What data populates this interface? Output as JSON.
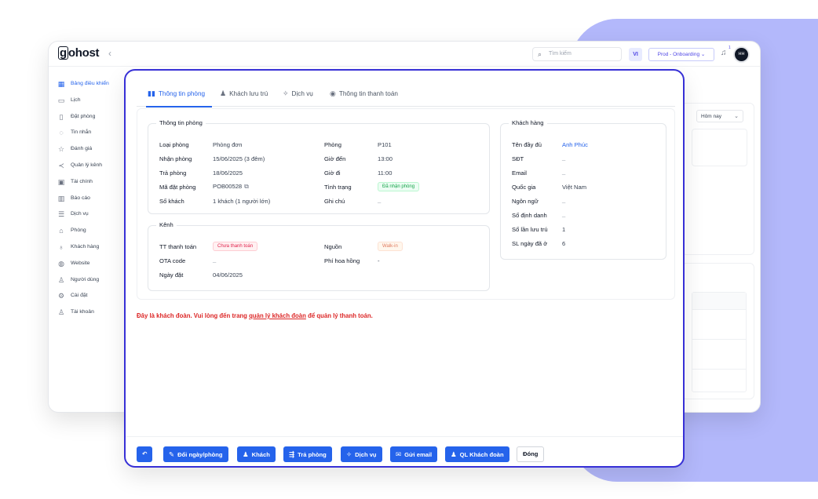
{
  "app": {
    "logo": "gohost",
    "collapse_icon": "chevron-left-icon",
    "search_placeholder": "Tìm kiếm",
    "lang": "VI",
    "env": "Prod - Onboarding",
    "notification_count": "1",
    "avatar_initials": "HH"
  },
  "sidebar": {
    "items": [
      {
        "label": "Bảng điều khiển",
        "icon": "dashboard-icon",
        "glyph": "▦"
      },
      {
        "label": "Lịch",
        "icon": "calendar-icon",
        "glyph": "▭"
      },
      {
        "label": "Đặt phòng",
        "icon": "book-icon",
        "glyph": "▯"
      },
      {
        "label": "Tin nhắn",
        "icon": "message-icon",
        "glyph": "◌"
      },
      {
        "label": "Đánh giá",
        "icon": "star-icon",
        "glyph": "☆"
      },
      {
        "label": "Quản lý kênh",
        "icon": "share-icon",
        "glyph": "≺"
      },
      {
        "label": "Tài chính",
        "icon": "wallet-icon",
        "glyph": "▣"
      },
      {
        "label": "Báo cáo",
        "icon": "chart-icon",
        "glyph": "▥"
      },
      {
        "label": "Dịch vụ",
        "icon": "list-icon",
        "glyph": "☰"
      },
      {
        "label": "Phòng",
        "icon": "building-icon",
        "glyph": "⌂"
      },
      {
        "label": "Khách hàng",
        "icon": "customers-icon",
        "glyph": "♁"
      },
      {
        "label": "Website",
        "icon": "globe-icon",
        "glyph": "◍"
      },
      {
        "label": "Người dùng",
        "icon": "users-icon",
        "glyph": "♙"
      },
      {
        "label": "Cài đặt",
        "icon": "settings-icon",
        "glyph": "⚙"
      },
      {
        "label": "Tài khoản",
        "icon": "account-icon",
        "glyph": "♙"
      }
    ]
  },
  "right_panel": {
    "filter": "Hôm nay"
  },
  "modal": {
    "tabs": [
      {
        "label": "Thông tin phòng",
        "icon": "room-info-icon",
        "glyph": "▮▮"
      },
      {
        "label": "Khách lưu trú",
        "icon": "guests-icon",
        "glyph": "♟"
      },
      {
        "label": "Dịch vụ",
        "icon": "sparkle-icon",
        "glyph": "✧"
      },
      {
        "label": "Thông tin thanh toán",
        "icon": "payment-icon",
        "glyph": "◉"
      }
    ],
    "room_info": {
      "legend": "Thông tin phòng",
      "room_type_label": "Loại phòng",
      "room_type": "Phòng đơn",
      "checkin_label": "Nhận phòng",
      "checkin": "15/06/2025 (3 đêm)",
      "checkout_label": "Trả phòng",
      "checkout": "18/06/2025",
      "booking_code_label": "Mã đặt phòng",
      "booking_code": "POB00528",
      "guests_label": "Số khách",
      "guests": "1 khách (1 người lớn)",
      "room_label": "Phòng",
      "room": "P101",
      "arrive_time_label": "Giờ đến",
      "arrive_time": "13:00",
      "leave_time_label": "Giờ đi",
      "leave_time": "11:00",
      "status_label": "Tình trạng",
      "status": "Đã nhận phòng",
      "note_label": "Ghi chú",
      "note": "_"
    },
    "channel": {
      "legend": "Kênh",
      "payment_status_label": "TT thanh toán",
      "payment_status": "Chưa thanh toán",
      "ota_code_label": "OTA code",
      "ota_code": "_",
      "booking_date_label": "Ngày đặt",
      "booking_date": "04/06/2025",
      "source_label": "Nguồn",
      "source": "Walk-in",
      "commission_label": "Phí hoa hồng",
      "commission": "-"
    },
    "customer": {
      "legend": "Khách hàng",
      "rows": [
        {
          "label": "Tên đầy đủ",
          "value": "Anh Phúc"
        },
        {
          "label": "SĐT",
          "value": "_"
        },
        {
          "label": "Email",
          "value": "_"
        },
        {
          "label": "Quốc gia",
          "value": "Việt Nam"
        },
        {
          "label": "Ngôn ngữ",
          "value": "_"
        },
        {
          "label": "Số định danh",
          "value": "_"
        },
        {
          "label": "Số lần lưu trú",
          "value": "1"
        },
        {
          "label": "SL ngày đã ở",
          "value": "6"
        }
      ]
    },
    "warning": {
      "before": "Đây là khách đoàn. Vui lòng đến trang ",
      "link": "quản lý khách đoàn",
      "after": " để quản lý thanh toán."
    },
    "footer": {
      "back_icon": "undo-icon",
      "change_label": "Đổi ngày/phòng",
      "guest_label": "Khách",
      "checkout_label": "Trả phòng",
      "service_label": "Dịch vụ",
      "email_label": "Gửi email",
      "group_label": "QL Khách đoàn",
      "close_label": "Đóng"
    }
  }
}
